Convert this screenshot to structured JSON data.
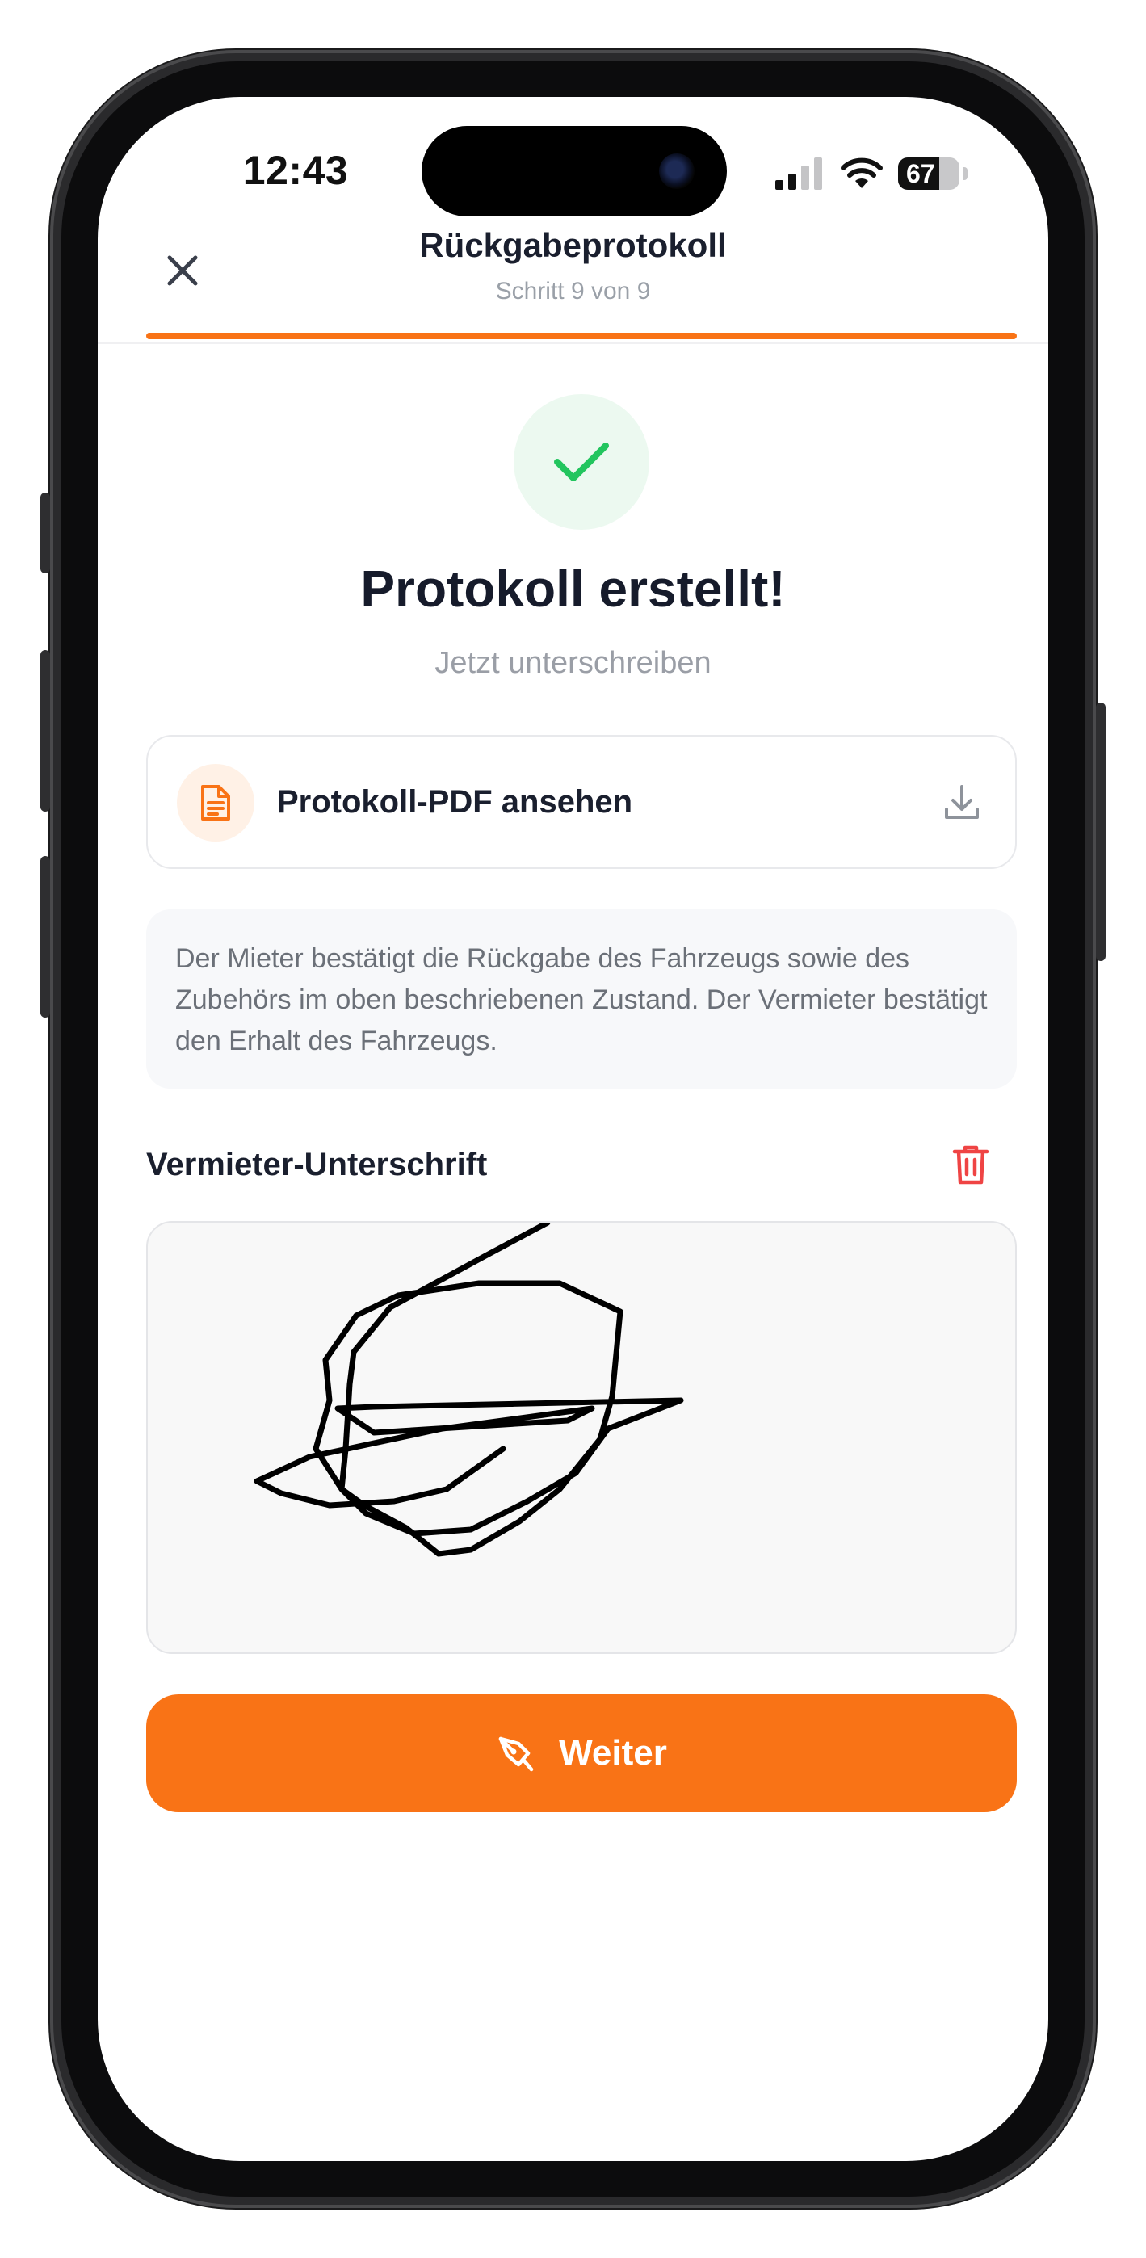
{
  "status_bar": {
    "time": "12:43",
    "battery_percent": "67",
    "battery_level": 0.67,
    "icons": [
      "signal-icon",
      "wifi-icon",
      "battery-icon"
    ]
  },
  "header": {
    "title": "Rückgabeprotokoll",
    "subtitle": "Schritt 9 von 9",
    "progress": 1.0,
    "close_icon": "close-icon"
  },
  "success": {
    "icon": "checkmark-icon",
    "title": "Protokoll erstellt!",
    "subtitle": "Jetzt unterschreiben"
  },
  "pdf_card": {
    "icon": "document-icon",
    "label": "Protokoll-PDF ansehen",
    "action_icon": "download-icon"
  },
  "notice": {
    "text": "Der Mieter bestätigt die Rückgabe des Fahrzeugs sowie des Zubehörs im oben beschriebenen Zustand. Der Vermieter bestätigt den Erhalt des Fahrzeugs."
  },
  "signature": {
    "label": "Vermieter-Unterschrift",
    "clear_icon": "trash-icon"
  },
  "primary_button": {
    "icon": "pen-icon",
    "label": "Weiter"
  },
  "colors": {
    "accent": "#f97316",
    "success": "#22c55e",
    "danger": "#ef4444",
    "text_primary": "#1a1f2e",
    "text_muted": "#9aa0a8"
  }
}
